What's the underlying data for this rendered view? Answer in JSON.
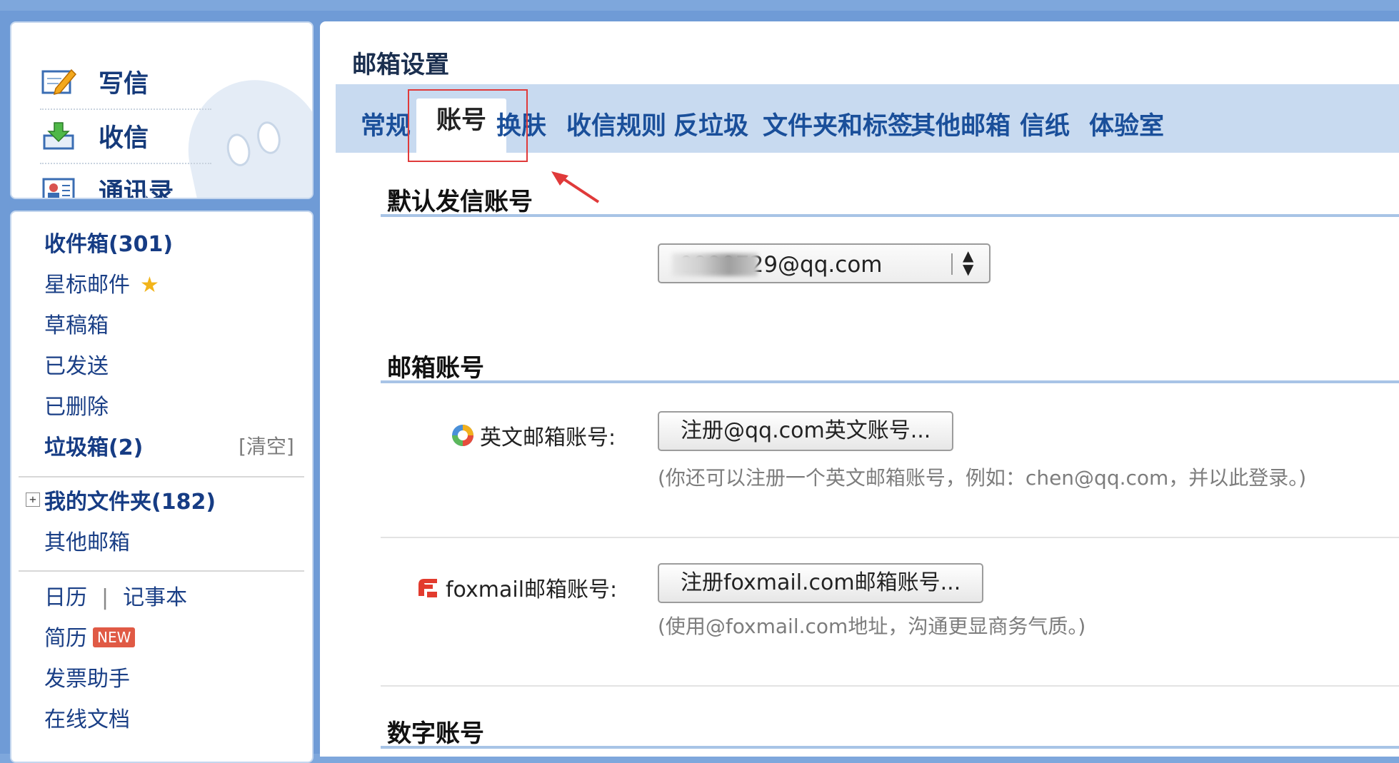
{
  "quick_actions": [
    {
      "label": "写信",
      "icon": "compose-icon"
    },
    {
      "label": "收信",
      "icon": "receive-icon"
    },
    {
      "label": "通讯录",
      "icon": "contacts-icon"
    }
  ],
  "folders": {
    "inbox": "收件箱(301)",
    "starred": "星标邮件",
    "drafts": "草稿箱",
    "sent": "已发送",
    "deleted": "已删除",
    "spam": "垃圾箱(2)",
    "spam_clear": "[清空]",
    "my_folders": "我的文件夹(182)",
    "other_mailboxes": "其他邮箱",
    "calendar": "日历",
    "separator": "|",
    "notepad": "记事本",
    "resume": "简历",
    "resume_badge": "NEW",
    "invoice": "发票助手",
    "online_docs": "在线文档"
  },
  "main": {
    "title": "邮箱设置",
    "tabs": [
      "常规",
      "账号",
      "换肤",
      "收信规则",
      "反垃圾",
      "文件夹和标签",
      "其他邮箱",
      "信纸",
      "体验室"
    ],
    "active_tab": "账号"
  },
  "default_sender": {
    "heading": "默认发信账号",
    "selected_value": "0990729@qq.com"
  },
  "mailbox_accounts": {
    "heading": "邮箱账号",
    "english_label": "英文邮箱账号:",
    "english_button": "注册@qq.com英文账号...",
    "english_hint": "(你还可以注册一个英文邮箱账号，例如：chen@qq.com，并以此登录。)",
    "foxmail_label": "foxmail邮箱账号:",
    "foxmail_button": "注册foxmail.com邮箱账号...",
    "foxmail_hint": "(使用@foxmail.com地址，沟通更显商务气质。)"
  },
  "numeric_account": {
    "heading": "数字账号"
  },
  "colors": {
    "page_bg": "#7ea7dc",
    "tabbar_bg": "#c8daf0",
    "link_blue": "#1a3f86",
    "annotation_red": "#e03a3a",
    "section_line": "#a8c4e6"
  }
}
